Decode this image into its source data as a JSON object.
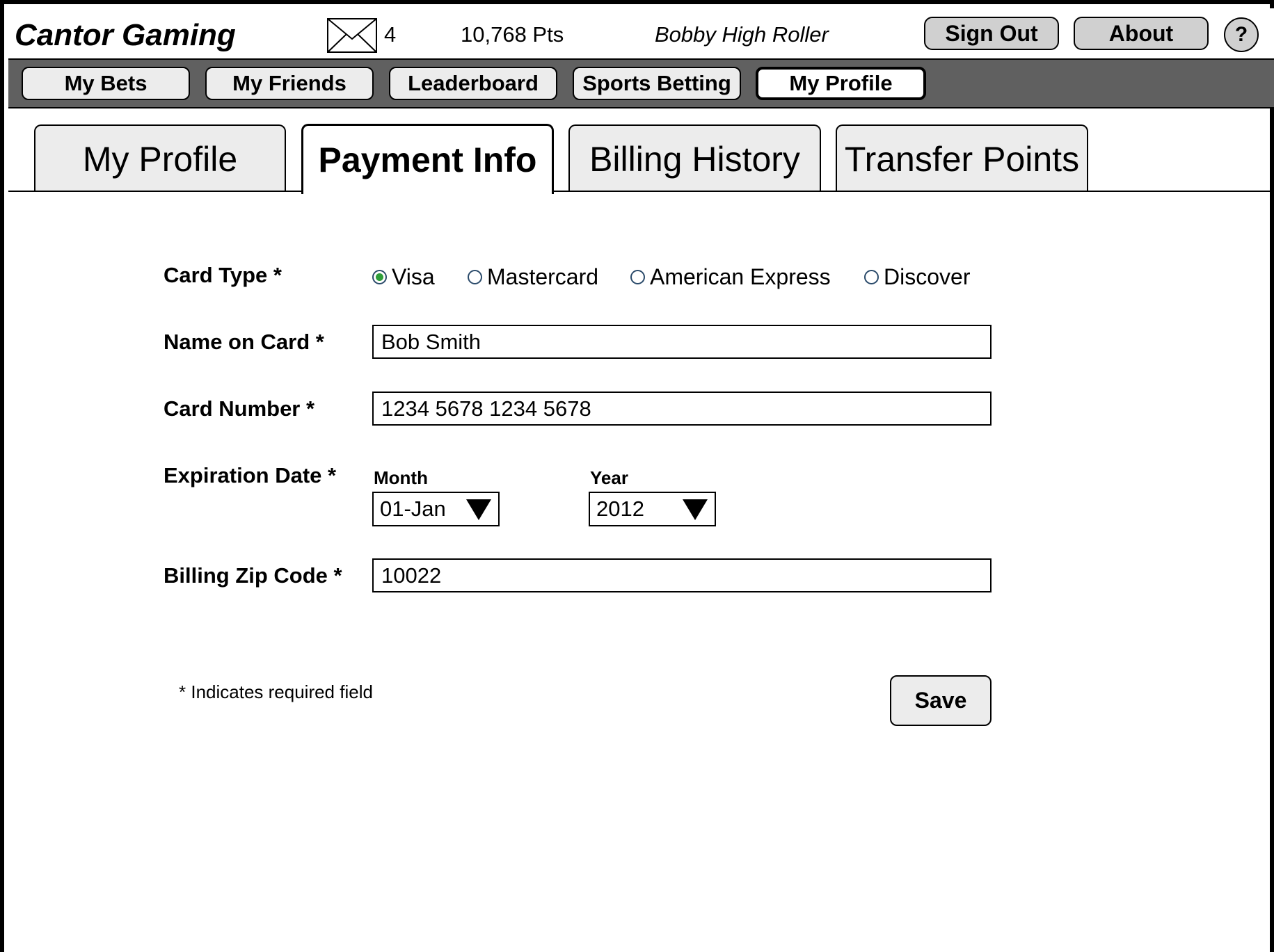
{
  "header": {
    "app_title": "Cantor Gaming",
    "mail_icon": "envelope-icon",
    "mail_count": "4",
    "points": "10,768 Pts",
    "username": "Bobby High Roller",
    "sign_out_label": "Sign Out",
    "about_label": "About",
    "help_label": "?"
  },
  "nav": {
    "items": [
      {
        "label": "My Bets",
        "active": false
      },
      {
        "label": "My Friends",
        "active": false
      },
      {
        "label": "Leaderboard",
        "active": false
      },
      {
        "label": "Sports Betting",
        "active": false
      },
      {
        "label": "My Profile",
        "active": true
      }
    ]
  },
  "tabs": [
    {
      "label": "My Profile",
      "active": false
    },
    {
      "label": "Payment Info",
      "active": true
    },
    {
      "label": "Billing History",
      "active": false
    },
    {
      "label": "Transfer Points",
      "active": false
    }
  ],
  "form": {
    "card_type": {
      "label": "Card Type *",
      "options": [
        {
          "label": "Visa",
          "selected": true
        },
        {
          "label": "Mastercard",
          "selected": false
        },
        {
          "label": "American Express",
          "selected": false
        },
        {
          "label": "Discover",
          "selected": false
        }
      ]
    },
    "name_on_card": {
      "label": "Name on Card *",
      "value": "Bob Smith"
    },
    "card_number": {
      "label": "Card Number *",
      "value": "1234 5678 1234 5678"
    },
    "expiration": {
      "label": "Expiration Date *",
      "month_label": "Month",
      "month_value": "01-Jan",
      "year_label": "Year",
      "year_value": "2012"
    },
    "zip": {
      "label": "Billing Zip Code *",
      "value": "10022"
    },
    "footnote": "* Indicates required field",
    "save_label": "Save"
  },
  "colors": {
    "nav_bar": "#606060",
    "button_gray": "#d0d0d0",
    "tab_gray": "#ececec",
    "radio_selected": "#2e9e3a"
  }
}
